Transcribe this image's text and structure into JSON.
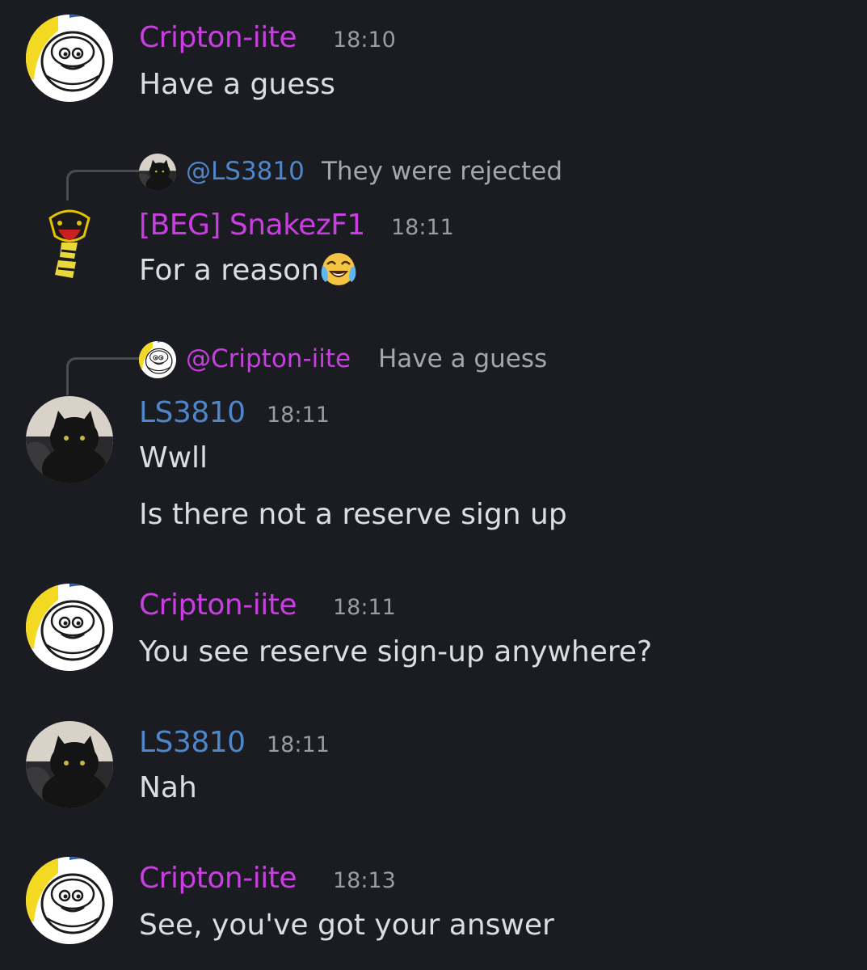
{
  "messages": [
    {
      "author": "Cripton-iite",
      "time": "18:10",
      "lines": [
        "Have a guess"
      ],
      "avatar": "michelin-avatar"
    },
    {
      "reply": {
        "mention": "@LS3810",
        "text": "They were rejected",
        "avatar": "cat-avatar"
      },
      "author": "[BEG] SnakezF1",
      "time": "18:11",
      "lines": [
        "For a reason"
      ],
      "emoji": "laughing-tears-emoji",
      "avatar": "snake-avatar"
    },
    {
      "reply": {
        "mention": "@Cripton-iite",
        "text": "Have a guess",
        "avatar": "michelin-avatar"
      },
      "author": "LS3810",
      "time": "18:11",
      "lines": [
        "Wwll",
        "Is there not a reserve sign up"
      ],
      "avatar": "cat-avatar"
    },
    {
      "author": "Cripton-iite",
      "time": "18:11",
      "lines": [
        "You see reserve sign-up anywhere?"
      ],
      "avatar": "michelin-avatar"
    },
    {
      "author": "LS3810",
      "time": "18:11",
      "lines": [
        "Nah"
      ],
      "avatar": "cat-avatar"
    },
    {
      "author": "Cripton-iite",
      "time": "18:13",
      "lines": [
        "See, you've got your answer"
      ],
      "avatar": "michelin-avatar"
    }
  ],
  "colors": {
    "background": "#1b1c21",
    "name_purple": "#c93ee0",
    "name_blue": "#4f86c9",
    "timestamp": "#9a9ca3",
    "message_text": "#dcdde0"
  }
}
